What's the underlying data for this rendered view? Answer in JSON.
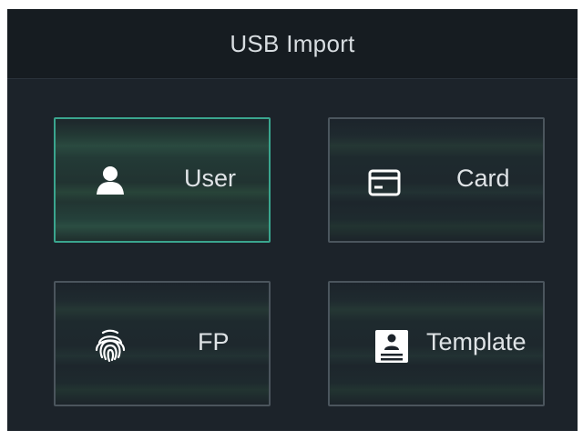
{
  "header": {
    "title": "USB Import"
  },
  "tiles": [
    {
      "label": "User",
      "icon": "user-icon",
      "selected": true
    },
    {
      "label": "Card",
      "icon": "card-icon",
      "selected": false
    },
    {
      "label": "FP",
      "icon": "fingerprint-icon",
      "selected": false
    },
    {
      "label": "Template",
      "icon": "template-icon",
      "selected": false
    }
  ],
  "colors": {
    "background": "#1c232a",
    "header_background": "#161c21",
    "tile_border": "#4b555d",
    "selected_border": "#3aa58e",
    "text": "#dfe3e6"
  }
}
